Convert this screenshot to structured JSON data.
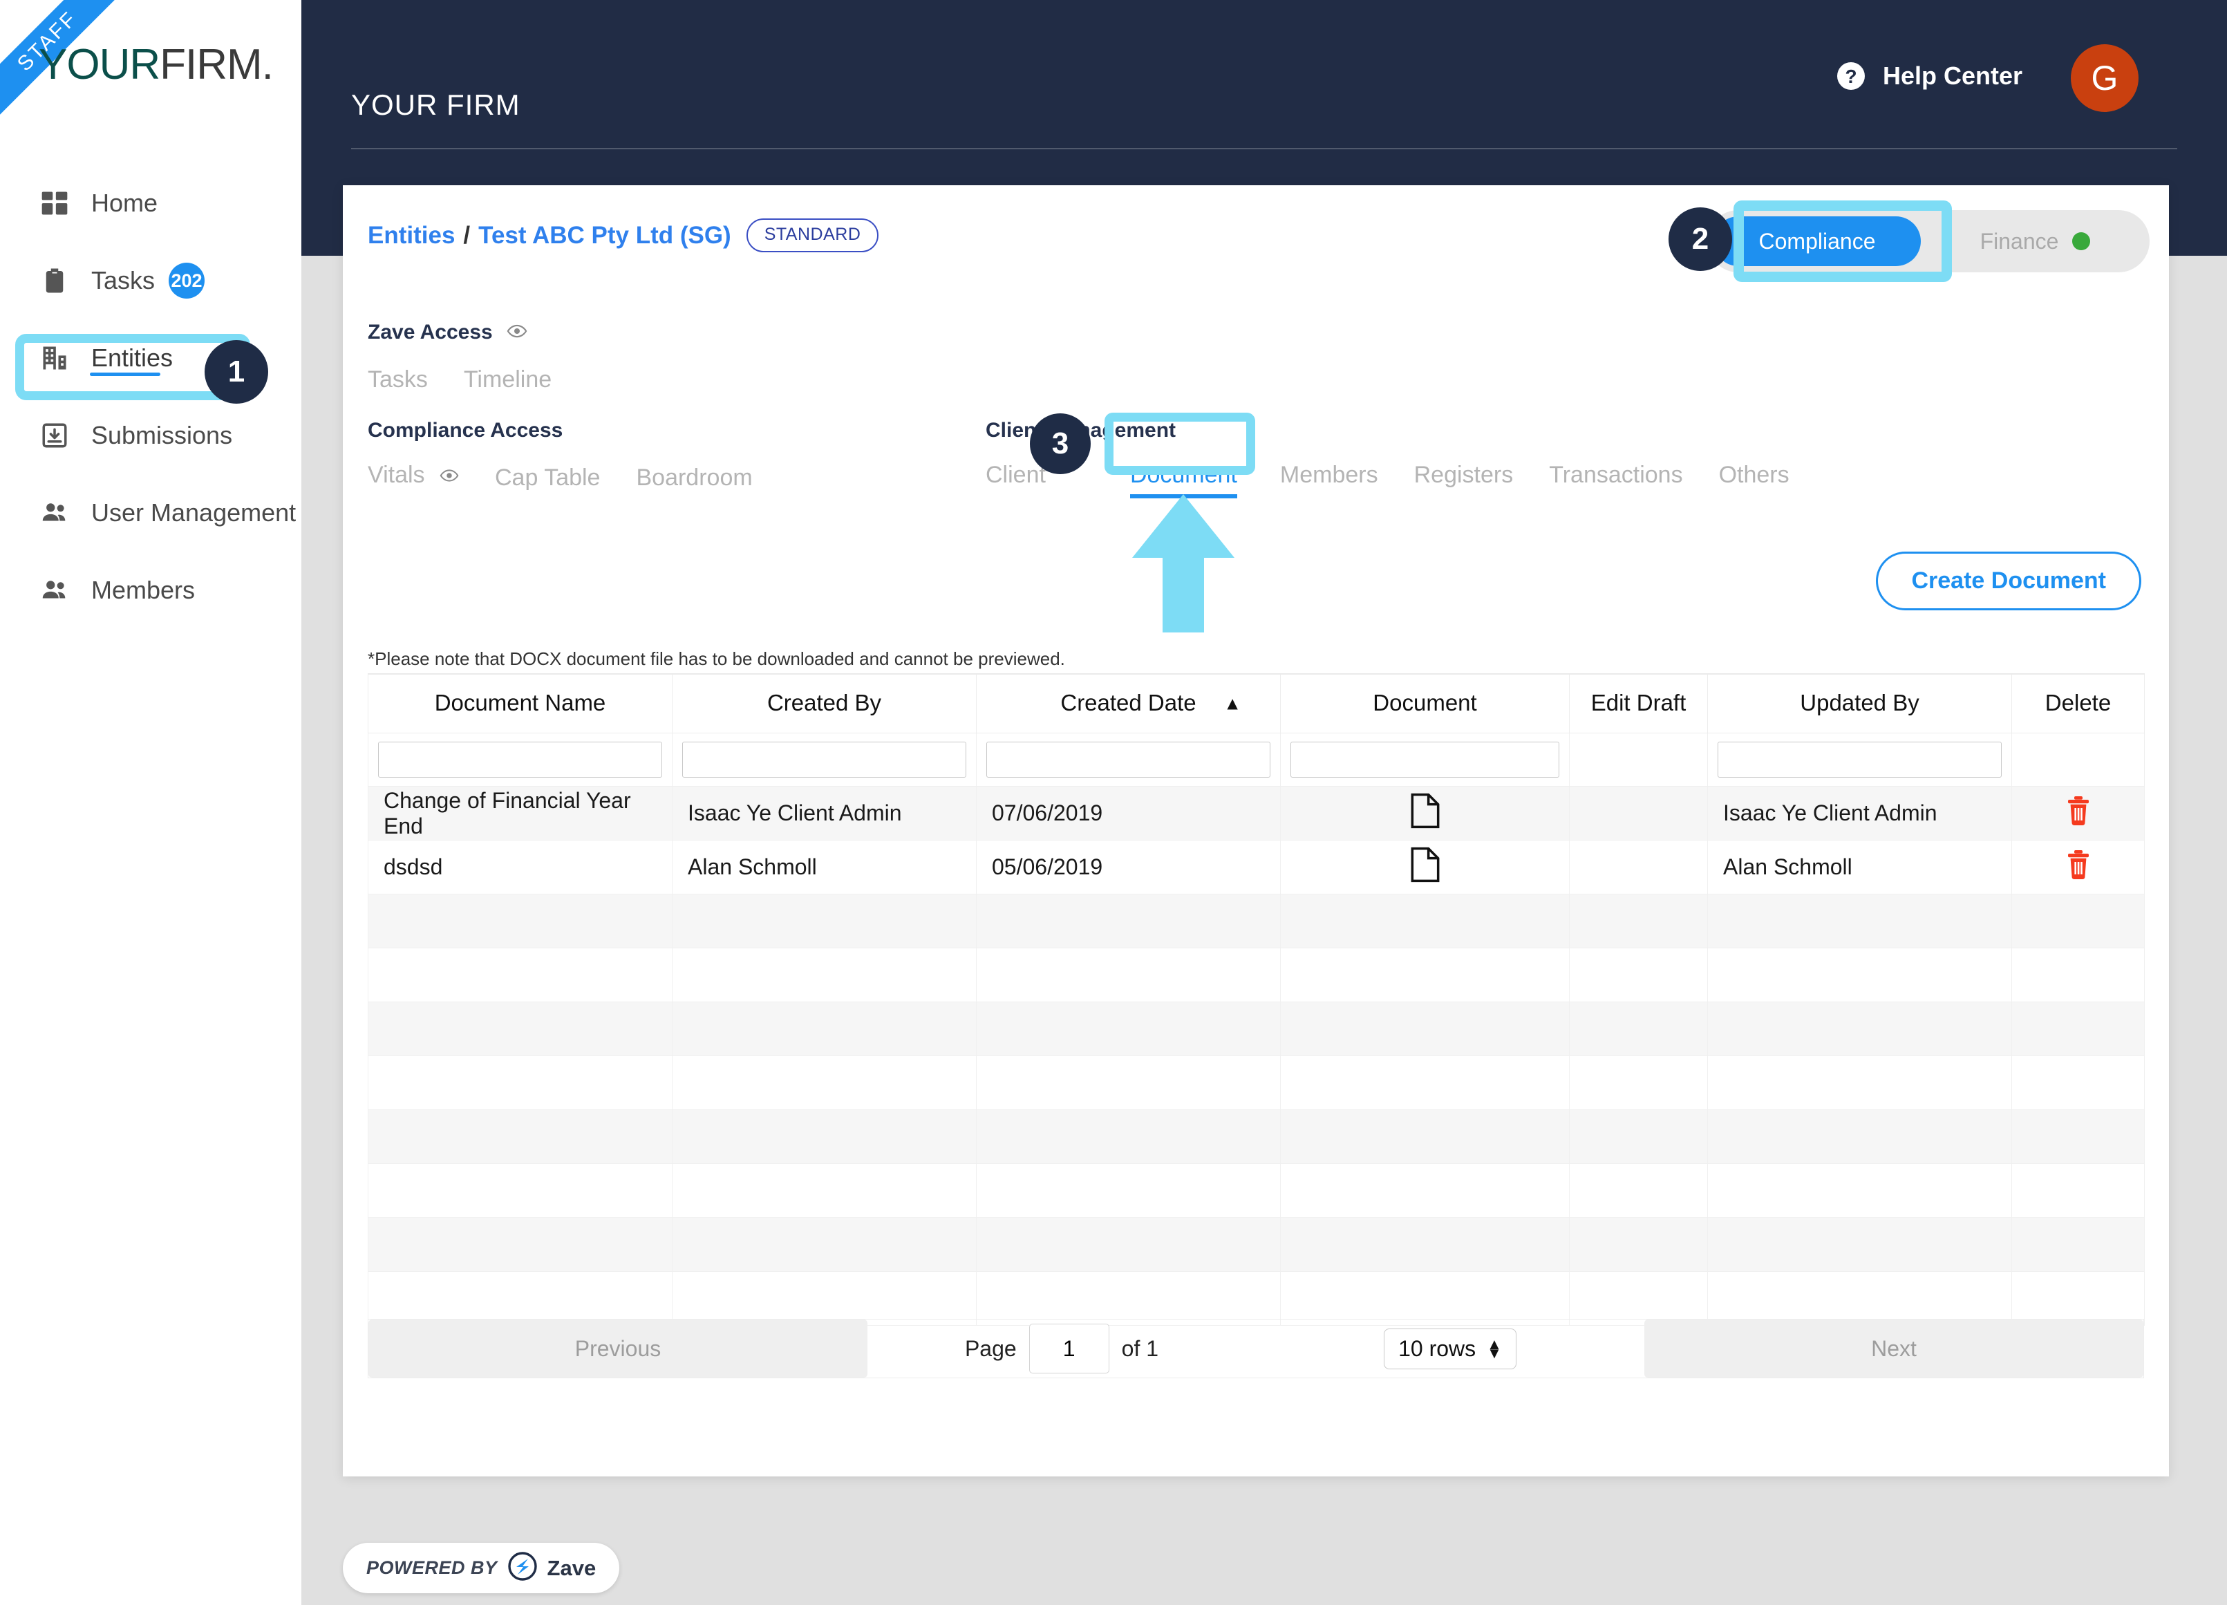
{
  "sidebar": {
    "ribbon_label": "STAFF",
    "brand_part1": "YOUR",
    "brand_part2": "FIRM.",
    "items": [
      {
        "label": "Home",
        "icon": "dashboard-icon",
        "badge": ""
      },
      {
        "label": "Tasks",
        "icon": "clipboard-icon",
        "badge": "202"
      },
      {
        "label": "Entities",
        "icon": "building-icon",
        "badge": ""
      },
      {
        "label": "Submissions",
        "icon": "inbox-download-icon",
        "badge": ""
      },
      {
        "label": "User Management",
        "icon": "people-icon",
        "badge": ""
      },
      {
        "label": "Members",
        "icon": "people-icon",
        "badge": ""
      }
    ]
  },
  "topbar": {
    "title": "YOUR FIRM",
    "help_label": "Help Center",
    "avatar_initial": "G",
    "avatar_color": "#C9400F"
  },
  "breadcrumb": {
    "root": "Entities",
    "separator": "/",
    "current": "Test ABC Pty Ltd (SG)",
    "badge": "STANDARD"
  },
  "segmented": {
    "active_label": "Compliance",
    "inactive_label": "Finance",
    "status_dot_color": "#39A93B"
  },
  "sections": {
    "zave_access": {
      "title": "Zave Access",
      "tabs": [
        "Tasks",
        "Timeline"
      ]
    },
    "compliance_access": {
      "title": "Compliance Access",
      "tabs": [
        "Vitals",
        "Cap Table",
        "Boardroom"
      ]
    },
    "client_management": {
      "title": "Client Management",
      "tabs": [
        "Client",
        "Document",
        "Members",
        "Registers",
        "Transactions",
        "Others"
      ],
      "active_tab": "Document"
    }
  },
  "actions": {
    "create_document": "Create Document"
  },
  "note": "*Please note that DOCX document file has to be downloaded and cannot be previewed.",
  "table": {
    "columns": [
      "Document Name",
      "Created By",
      "Created Date",
      "Document",
      "Edit Draft",
      "Updated By",
      "Delete"
    ],
    "sort_column": "Created Date",
    "sort_indicator": "▲",
    "filters": [
      "",
      "",
      "",
      "",
      "",
      "",
      ""
    ],
    "filter_placeholder": "",
    "rows": [
      {
        "document_name": "Change of Financial Year End",
        "created_by": "Isaac Ye Client Admin",
        "created_date": "07/06/2019",
        "document_icon": "file-icon",
        "edit_draft": "",
        "updated_by": "Isaac Ye Client Admin",
        "delete_icon": "trash-icon"
      },
      {
        "document_name": "dsdsd",
        "created_by": "Alan Schmoll",
        "created_date": "05/06/2019",
        "document_icon": "file-icon",
        "edit_draft": "",
        "updated_by": "Alan Schmoll",
        "delete_icon": "trash-icon"
      }
    ],
    "empty_row_count": 8
  },
  "pagination": {
    "previous_label": "Previous",
    "page_label": "Page",
    "page_value": "1",
    "of_label": "of 1",
    "rows_per_page": "10 rows",
    "next_label": "Next"
  },
  "callouts": [
    {
      "number": "1",
      "target": "Entities"
    },
    {
      "number": "2",
      "target": "Compliance"
    },
    {
      "number": "3",
      "target": "Document"
    }
  ],
  "footer": {
    "powered_by": "POWERED BY",
    "brand": "Zave"
  }
}
